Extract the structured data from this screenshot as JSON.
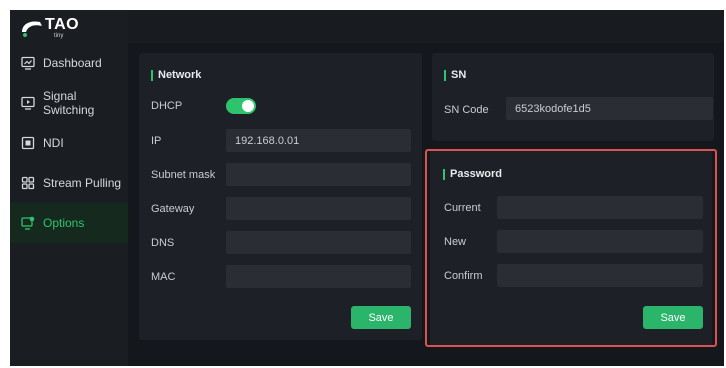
{
  "brand": {
    "name": "TAO",
    "sub": "tiny"
  },
  "sidebar": {
    "items": [
      {
        "label": "Dashboard",
        "icon": "dashboard-icon"
      },
      {
        "label": "Signal Switching",
        "icon": "monitor-play-icon"
      },
      {
        "label": "NDI",
        "icon": "ndi-icon"
      },
      {
        "label": "Stream Pulling",
        "icon": "grid-icon"
      },
      {
        "label": "Options",
        "icon": "settings-screen-icon",
        "active": true
      }
    ]
  },
  "network": {
    "title": "Network",
    "dhcp_label": "DHCP",
    "dhcp_enabled": true,
    "ip_label": "IP",
    "ip_value": "192.168.0.01",
    "subnet_label": "Subnet mask",
    "subnet_value": "",
    "gateway_label": "Gateway",
    "gateway_value": "",
    "dns_label": "DNS",
    "dns_value": "",
    "mac_label": "MAC",
    "mac_value": "",
    "save_label": "Save"
  },
  "sn": {
    "title": "SN",
    "code_label": "SN Code",
    "code_value": "6523kodofe1d5"
  },
  "password": {
    "title": "Password",
    "current_label": "Current",
    "current_value": "",
    "new_label": "New",
    "new_value": "",
    "confirm_label": "Confirm",
    "confirm_value": "",
    "save_label": "Save"
  },
  "colors": {
    "accent": "#2ec46d",
    "highlight": "#d9534f",
    "background": "#14171c"
  }
}
